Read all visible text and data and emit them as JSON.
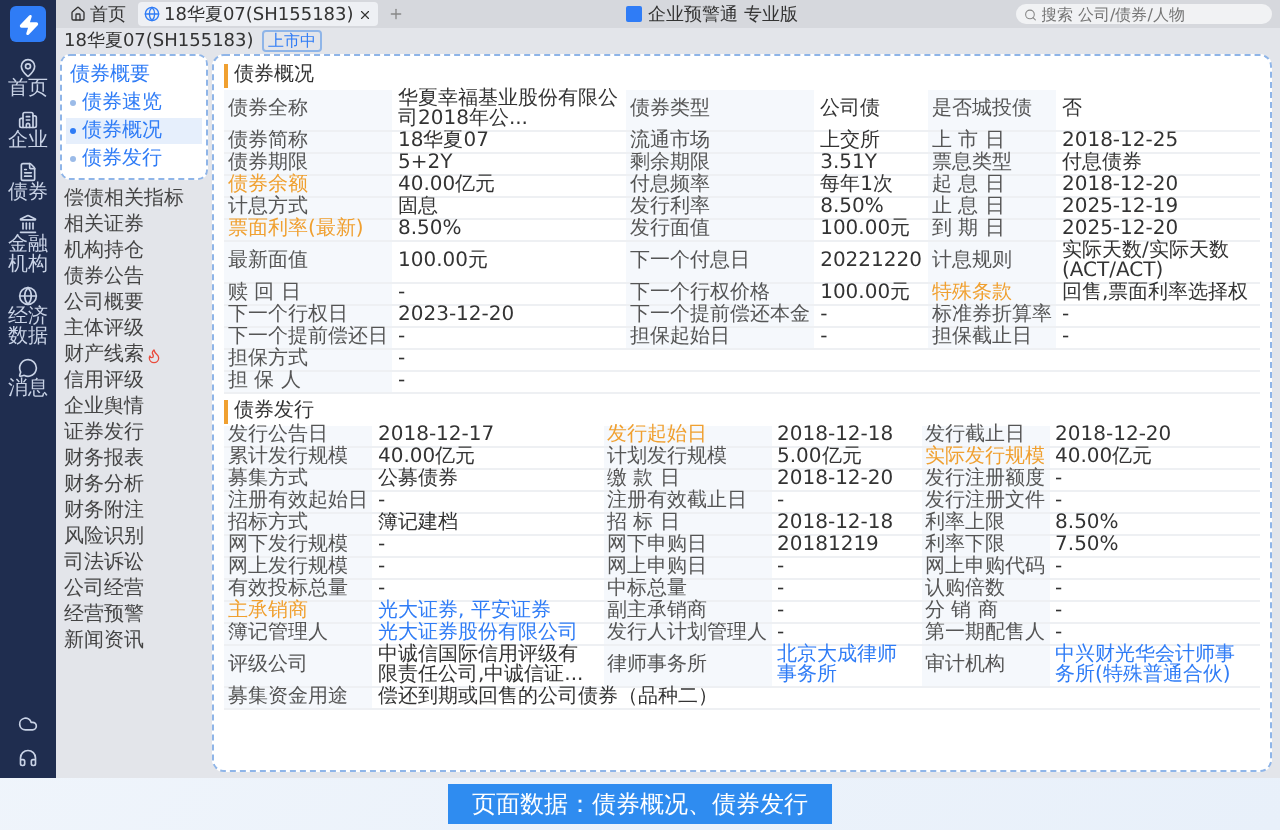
{
  "window": {
    "title": "企业预警通 专业版",
    "search": {
      "placeholder": "搜索 公司/债券/人物"
    }
  },
  "tabs": [
    {
      "label": "首页",
      "kind": "home",
      "selected": false
    },
    {
      "label": "18华夏07(SH155183)",
      "kind": "page",
      "selected": true
    }
  ],
  "nav": [
    {
      "label": "首页",
      "kind": "pin"
    },
    {
      "label": "企业",
      "kind": "building"
    },
    {
      "label": "债券",
      "kind": "file"
    },
    {
      "label": "金融机构",
      "kind": "bank"
    },
    {
      "label": "经济数据",
      "kind": "globe"
    },
    {
      "label": "消息",
      "kind": "chat"
    }
  ],
  "bond_header": {
    "code": "18华夏07(SH155183)",
    "tag": "上市中"
  },
  "submenu": {
    "title": "债券概要",
    "items": [
      {
        "label": "债券速览",
        "selected": false
      },
      {
        "label": "债券概况",
        "selected": true
      },
      {
        "label": "债券发行",
        "selected": false
      }
    ]
  },
  "side_list": [
    {
      "label": "偿债相关指标",
      "hot": false
    },
    {
      "label": "相关证券",
      "hot": false
    },
    {
      "label": "机构持仓",
      "hot": false
    },
    {
      "label": "债券公告",
      "hot": false
    },
    {
      "label": "公司概要",
      "hot": false
    },
    {
      "label": "主体评级",
      "hot": false
    },
    {
      "label": "财产线索",
      "hot": true
    },
    {
      "label": "信用评级",
      "hot": false
    },
    {
      "label": "企业舆情",
      "hot": false
    },
    {
      "label": "证券发行",
      "hot": false
    },
    {
      "label": "财务报表",
      "hot": false
    },
    {
      "label": "财务分析",
      "hot": false
    },
    {
      "label": "财务附注",
      "hot": false
    },
    {
      "label": "风险识别",
      "hot": false
    },
    {
      "label": "司法诉讼",
      "hot": false
    },
    {
      "label": "公司经营",
      "hot": false
    },
    {
      "label": "经营预警",
      "hot": false
    },
    {
      "label": "新闻资讯",
      "hot": false
    }
  ],
  "overview": {
    "title": "债券概况",
    "rows": [
      [
        {
          "label": "债券全称",
          "value": "华夏幸福基业股份有限公司2018年公...",
          "highlighted": false,
          "link": false
        },
        {
          "label": "债券类型",
          "value": "公司债",
          "highlighted": false,
          "link": false
        },
        {
          "label": "是否城投债",
          "value": "否",
          "highlighted": false,
          "link": false
        }
      ],
      [
        {
          "label": "债券简称",
          "value": "18华夏07",
          "highlighted": false,
          "link": false
        },
        {
          "label": "流通市场",
          "value": "上交所",
          "highlighted": false,
          "link": false
        },
        {
          "label": "上 市 日",
          "value": "2018-12-25",
          "highlighted": false,
          "link": false
        }
      ],
      [
        {
          "label": "债券期限",
          "value": "5+2Y",
          "highlighted": false,
          "link": false
        },
        {
          "label": "剩余期限",
          "value": "3.51Y",
          "highlighted": false,
          "link": false
        },
        {
          "label": "票息类型",
          "value": "付息债券",
          "highlighted": false,
          "link": false
        }
      ],
      [
        {
          "label": "债券余额",
          "value": "40.00亿元",
          "highlighted": true,
          "link": false
        },
        {
          "label": "付息频率",
          "value": "每年1次",
          "highlighted": false,
          "link": false
        },
        {
          "label": "起 息 日",
          "value": "2018-12-20",
          "highlighted": false,
          "link": false
        }
      ],
      [
        {
          "label": "计息方式",
          "value": "固息",
          "highlighted": false,
          "link": false
        },
        {
          "label": "发行利率",
          "value": "8.50%",
          "highlighted": false,
          "link": false
        },
        {
          "label": "止 息 日",
          "value": "2025-12-19",
          "highlighted": false,
          "link": false
        }
      ],
      [
        {
          "label": "票面利率(最新)",
          "value": "8.50%",
          "highlighted": true,
          "link": false
        },
        {
          "label": "发行面值",
          "value": "100.00元",
          "highlighted": false,
          "link": false
        },
        {
          "label": "到 期 日",
          "value": "2025-12-20",
          "highlighted": false,
          "link": false
        }
      ],
      [
        {
          "label": "最新面值",
          "value": "100.00元",
          "highlighted": false,
          "link": false
        },
        {
          "label": "下一个付息日",
          "value": "20221220",
          "highlighted": false,
          "link": false
        },
        {
          "label": "计息规则",
          "value": "实际天数/实际天数(ACT/ACT)",
          "highlighted": false,
          "link": false
        }
      ],
      [
        {
          "label": "赎 回 日",
          "value": "-",
          "highlighted": false,
          "link": false
        },
        {
          "label": "下一个行权价格",
          "value": "100.00元",
          "highlighted": false,
          "link": false
        },
        {
          "label": "特殊条款",
          "value": "回售,票面利率选择权",
          "highlighted": true,
          "link": false
        }
      ],
      [
        {
          "label": "下一个行权日",
          "value": "2023-12-20",
          "highlighted": false,
          "link": false
        },
        {
          "label": "下一个提前偿还本金",
          "value": "-",
          "highlighted": false,
          "link": false
        },
        {
          "label": "标准券折算率",
          "value": "-",
          "highlighted": false,
          "link": false
        }
      ],
      [
        {
          "label": "下一个提前偿还日",
          "value": "-",
          "highlighted": false,
          "link": false
        },
        {
          "label": "担保起始日",
          "value": "-",
          "highlighted": false,
          "link": false
        },
        {
          "label": "担保截止日",
          "value": "-",
          "highlighted": false,
          "link": false
        }
      ],
      [
        {
          "label": "担保方式",
          "value": "-",
          "highlighted": false,
          "link": false
        }
      ],
      [
        {
          "label": "担 保 人",
          "value": "-",
          "highlighted": false,
          "link": false
        }
      ]
    ]
  },
  "issuance": {
    "title": "债券发行",
    "rows": [
      [
        {
          "label": "发行公告日",
          "value": "2018-12-17",
          "highlighted": false,
          "link": false
        },
        {
          "label": "发行起始日",
          "value": "2018-12-18",
          "highlighted": true,
          "link": false
        },
        {
          "label": "发行截止日",
          "value": "2018-12-20",
          "highlighted": false,
          "link": false
        }
      ],
      [
        {
          "label": "累计发行规模",
          "value": "40.00亿元",
          "highlighted": false,
          "link": false
        },
        {
          "label": "计划发行规模",
          "value": "5.00亿元",
          "highlighted": false,
          "link": false
        },
        {
          "label": "实际发行规模",
          "value": "40.00亿元",
          "highlighted": true,
          "link": false
        }
      ],
      [
        {
          "label": "募集方式",
          "value": "公募债券",
          "highlighted": false,
          "link": false
        },
        {
          "label": "缴 款 日",
          "value": "2018-12-20",
          "highlighted": false,
          "link": false
        },
        {
          "label": "发行注册额度",
          "value": "-",
          "highlighted": false,
          "link": false
        }
      ],
      [
        {
          "label": "注册有效起始日",
          "value": "-",
          "highlighted": false,
          "link": false
        },
        {
          "label": "注册有效截止日",
          "value": "-",
          "highlighted": false,
          "link": false
        },
        {
          "label": "发行注册文件",
          "value": "-",
          "highlighted": false,
          "link": false
        }
      ],
      [
        {
          "label": "招标方式",
          "value": "簿记建档",
          "highlighted": false,
          "link": false
        },
        {
          "label": "招 标 日",
          "value": "2018-12-18",
          "highlighted": false,
          "link": false
        },
        {
          "label": "利率上限",
          "value": "8.50%",
          "highlighted": false,
          "link": false
        }
      ],
      [
        {
          "label": "网下发行规模",
          "value": "-",
          "highlighted": false,
          "link": false
        },
        {
          "label": "网下申购日",
          "value": "20181219",
          "highlighted": false,
          "link": false
        },
        {
          "label": "利率下限",
          "value": "7.50%",
          "highlighted": false,
          "link": false
        }
      ],
      [
        {
          "label": "网上发行规模",
          "value": "-",
          "highlighted": false,
          "link": false
        },
        {
          "label": "网上申购日",
          "value": "-",
          "highlighted": false,
          "link": false
        },
        {
          "label": "网上申购代码",
          "value": "-",
          "highlighted": false,
          "link": false
        }
      ],
      [
        {
          "label": "有效投标总量",
          "value": "-",
          "highlighted": false,
          "link": false
        },
        {
          "label": "中标总量",
          "value": "-",
          "highlighted": false,
          "link": false
        },
        {
          "label": "认购倍数",
          "value": "-",
          "highlighted": false,
          "link": false
        }
      ],
      [
        {
          "label": "主承销商",
          "value": "光大证券, 平安证券",
          "highlighted": true,
          "link": true
        },
        {
          "label": "副主承销商",
          "value": "-",
          "highlighted": false,
          "link": false
        },
        {
          "label": "分 销 商",
          "value": "-",
          "highlighted": false,
          "link": false
        }
      ],
      [
        {
          "label": "簿记管理人",
          "value": "光大证券股份有限公司",
          "highlighted": false,
          "link": true
        },
        {
          "label": "发行人计划管理人",
          "value": "-",
          "highlighted": false,
          "link": false
        },
        {
          "label": "第一期配售人",
          "value": "-",
          "highlighted": false,
          "link": false
        }
      ],
      [
        {
          "label": "评级公司",
          "value": "中诚信国际信用评级有限责任公司,中诚信证...",
          "highlighted": false,
          "link": false
        },
        {
          "label": "律师事务所",
          "value": "北京大成律师事务所",
          "highlighted": false,
          "link": true
        },
        {
          "label": "审计机构",
          "value": "中兴财光华会计师事务所(特殊普通合伙)",
          "highlighted": false,
          "link": true
        }
      ],
      [
        {
          "label": "募集资金用途",
          "value": "偿还到期或回售的公司债券（品种二）",
          "highlighted": false,
          "link": false
        }
      ]
    ]
  },
  "caption": "页面数据：债券概况、债券发行"
}
